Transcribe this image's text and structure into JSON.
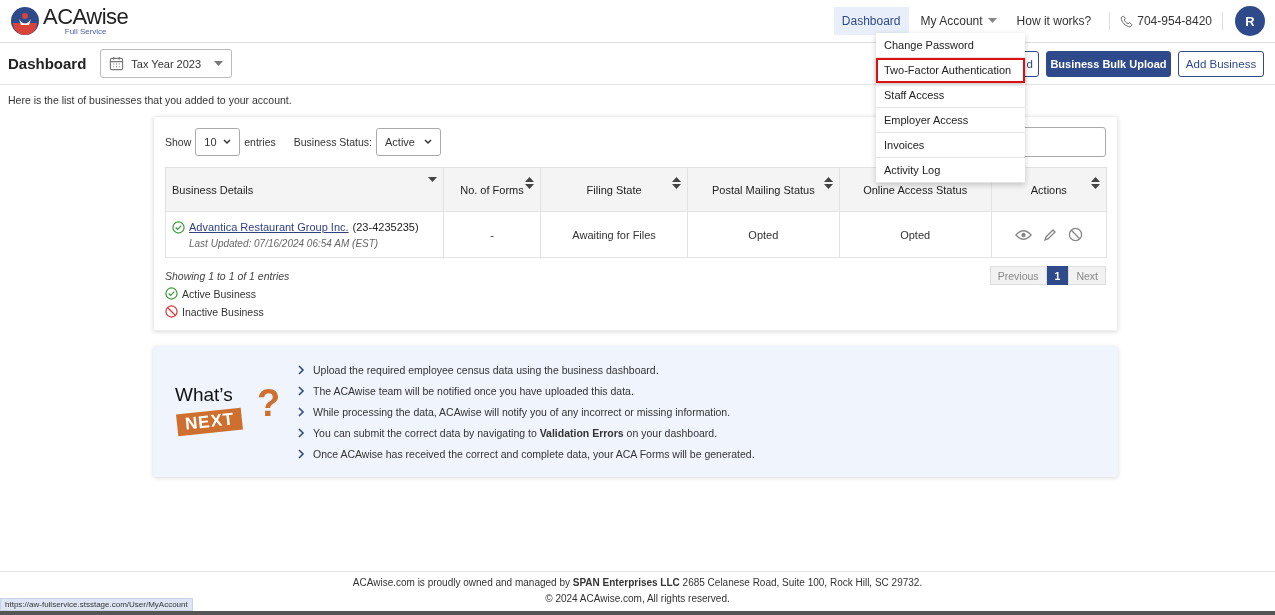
{
  "header": {
    "logo": {
      "name": "ACAwise",
      "tagline": "Full Service"
    },
    "nav": [
      {
        "label": "Dashboard",
        "selected": true,
        "kind": "link"
      },
      {
        "label": "My Account",
        "selected": false,
        "kind": "dropdown"
      },
      {
        "label": "How it works?",
        "selected": false,
        "kind": "link"
      }
    ],
    "phone": "704-954-8420",
    "avatar": "R"
  },
  "account_menu": [
    {
      "label": "Change Password",
      "selected": false
    },
    {
      "label": "Two-Factor Authentication",
      "selected": true
    },
    {
      "label": "Staff Access",
      "selected": false
    },
    {
      "label": "Employer Access",
      "selected": false
    },
    {
      "label": "Invoices",
      "selected": false
    },
    {
      "label": "Activity Log",
      "selected": false
    }
  ],
  "toolbar": {
    "title": "Dashboard",
    "tax_year": "Tax Year 2023",
    "buttons": [
      {
        "label": "d",
        "kind": "outline"
      },
      {
        "label": "Business Bulk Upload",
        "kind": "primary"
      },
      {
        "label": "Add Business",
        "kind": "outline"
      }
    ]
  },
  "intro": "Here is the list of businesses that you added to your account.",
  "table_controls": {
    "show_label": "Show",
    "page_size": "10",
    "entries_label": "entries",
    "status_label": "Business Status:",
    "status_value": "Active"
  },
  "table": {
    "columns": [
      {
        "label": "Business Details",
        "kind": "sorted"
      },
      {
        "label": "No. of Forms",
        "kind": "sortable"
      },
      {
        "label": "Filing State",
        "kind": "sortable"
      },
      {
        "label": "Postal Mailing Status",
        "kind": "sortable"
      },
      {
        "label": "Online Access Status"
      },
      {
        "label": "Actions",
        "kind": "sortable"
      }
    ],
    "rows": [
      {
        "business": "Advantica Restaurant Group Inc.",
        "ein": "(23-4235235)",
        "active": true,
        "last_updated": "Last Updated: 07/16/2024 06:54 AM (EST)",
        "forms": "-",
        "filing_state": "Awaiting for Files",
        "postal": "Opted",
        "online": "Opted"
      }
    ]
  },
  "info": "Showing 1 to 1 of 1 entries",
  "pagination": [
    {
      "label": "Previous",
      "disabled": true,
      "selected": false
    },
    {
      "label": "1",
      "disabled": false,
      "selected": true
    },
    {
      "label": "Next",
      "disabled": true,
      "selected": false
    }
  ],
  "legend": [
    {
      "label": "Active Business",
      "kind": "active"
    },
    {
      "label": "Inactive Business",
      "kind": "inactive"
    }
  ],
  "whats_next": {
    "word": "What’s",
    "badge": "NEXT",
    "mark": "?",
    "steps": [
      "Upload the required employee census data using the business dashboard.",
      "The ACAwise team will be notified once you have uploaded this data.",
      "While processing the data, ACAwise will notify you of any incorrect or missing information.",
      "You can submit the correct data by navigating to **Validation Errors** on your dashboard.",
      "Once ACAwise has received the correct and complete data, your ACA Forms will be generated."
    ]
  },
  "footer": [
    "ACAwise.com is proudly owned and managed by **SPAN Enterprises LLC** 2685 Celanese Road, Suite 100, Rock Hill, SC 29732.",
    "© 2024 ACAwise.com, All rights reserved."
  ],
  "status_url": "https://aw-fullservice.stsstage.com/User/MyAccount"
}
